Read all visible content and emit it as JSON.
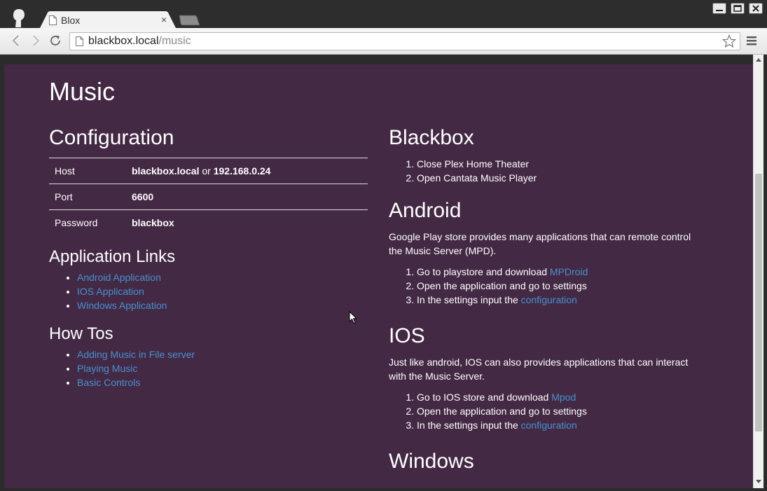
{
  "browser": {
    "tab_title": "Blox",
    "tab_close": "×",
    "url_host": "blackbox.local",
    "url_path": "/music"
  },
  "page": {
    "title": "Music",
    "configuration": {
      "heading": "Configuration",
      "rows": [
        {
          "key": "Host",
          "value": "blackbox.local",
          "sep": " or ",
          "value2": "192.168.0.24"
        },
        {
          "key": "Port",
          "value": "6600"
        },
        {
          "key": "Password",
          "value": "blackbox"
        }
      ]
    },
    "application_links": {
      "heading": "Application Links",
      "items": [
        "Android Application",
        "IOS Application",
        "Windows Application"
      ]
    },
    "howtos": {
      "heading": "How Tos",
      "items": [
        "Adding Music in File server",
        "Playing Music",
        "Basic Controls"
      ]
    },
    "blackbox": {
      "heading": "Blackbox",
      "steps": [
        "Close Plex Home Theater",
        "Open Cantata Music Player"
      ]
    },
    "android": {
      "heading": "Android",
      "description": "Google Play store provides many applications that can remote control the Music Server (MPD).",
      "step1_text": "Go to playstore and download ",
      "step1_link": "MPDroid",
      "step2": "Open the application and go to settings",
      "step3_text": "In the settings input the ",
      "step3_link": "configuration"
    },
    "ios": {
      "heading": "IOS",
      "description": "Just like android, IOS can also provides applications that can interact with the Music Server.",
      "step1_text": "Go to IOS store and download ",
      "step1_link": "Mpod",
      "step2": "Open the application and go to settings",
      "step3_text": "In the settings input the ",
      "step3_link": "configuration"
    },
    "windows": {
      "heading": "Windows"
    }
  },
  "colors": {
    "page_background": "#432944",
    "link": "#4a90d0",
    "text": "#ffffff"
  }
}
